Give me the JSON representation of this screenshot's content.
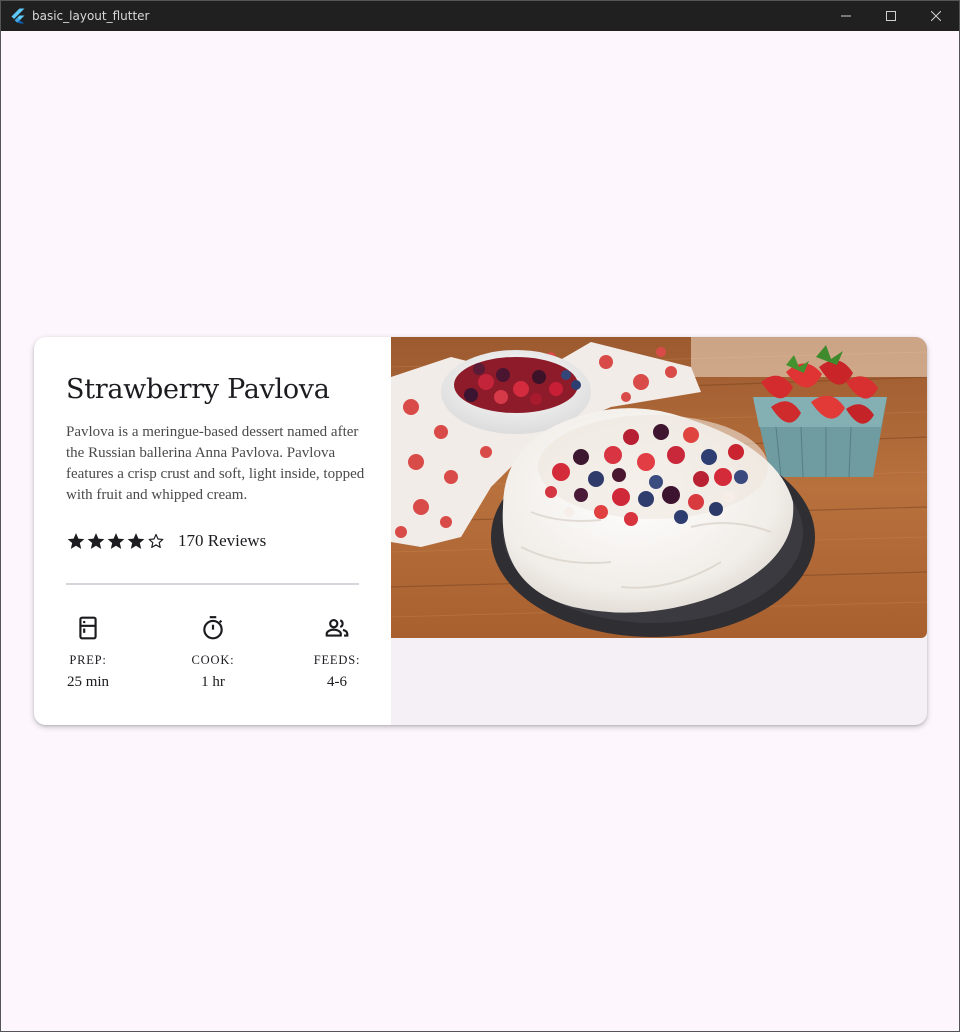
{
  "window": {
    "title": "basic_layout_flutter",
    "icon": "flutter-logo-icon"
  },
  "recipe": {
    "title": "Strawberry Pavlova",
    "description": "Pavlova is a meringue-based dessert named after the Russian ballerina Anna Pavlova. Pavlova features a crisp crust and soft, light inside, topped with fruit and whipped cream.",
    "rating": {
      "value": 4,
      "max": 5,
      "reviews_label": "170 Reviews"
    },
    "stats": [
      {
        "icon": "kitchen-icon",
        "label": "PREP:",
        "value": "25 min"
      },
      {
        "icon": "timer-icon",
        "label": "COOK:",
        "value": "1 hr"
      },
      {
        "icon": "people-icon",
        "label": "FEEDS:",
        "value": "4-6"
      }
    ],
    "image_subject": "strawberry-pavlova-photo"
  },
  "colors": {
    "window_background": "#fdf7fd",
    "card_background": "#f5eff6",
    "panel_background": "#ffffff",
    "titlebar": "#202020",
    "text_primary": "#1c1b1f"
  }
}
